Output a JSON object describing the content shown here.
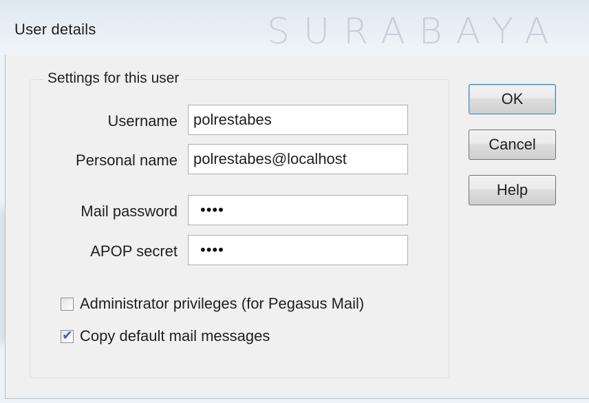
{
  "window": {
    "title": "User details"
  },
  "watermark": "SURABAYA",
  "group": {
    "label": "Settings for this user"
  },
  "fields": {
    "username": {
      "label": "Username",
      "value": "polrestabes"
    },
    "personal_name": {
      "label": "Personal name",
      "value": "polrestabes@localhost"
    },
    "mail_password": {
      "label": "Mail password",
      "masked": "••••"
    },
    "apop_secret": {
      "label": "APOP secret",
      "masked": "••••"
    }
  },
  "checkboxes": {
    "admin": {
      "label": "Administrator privileges (for Pegasus Mail)",
      "checked": false
    },
    "copy_default": {
      "label": "Copy default mail messages",
      "checked": true
    }
  },
  "buttons": {
    "ok": "OK",
    "cancel": "Cancel",
    "help": "Help"
  }
}
